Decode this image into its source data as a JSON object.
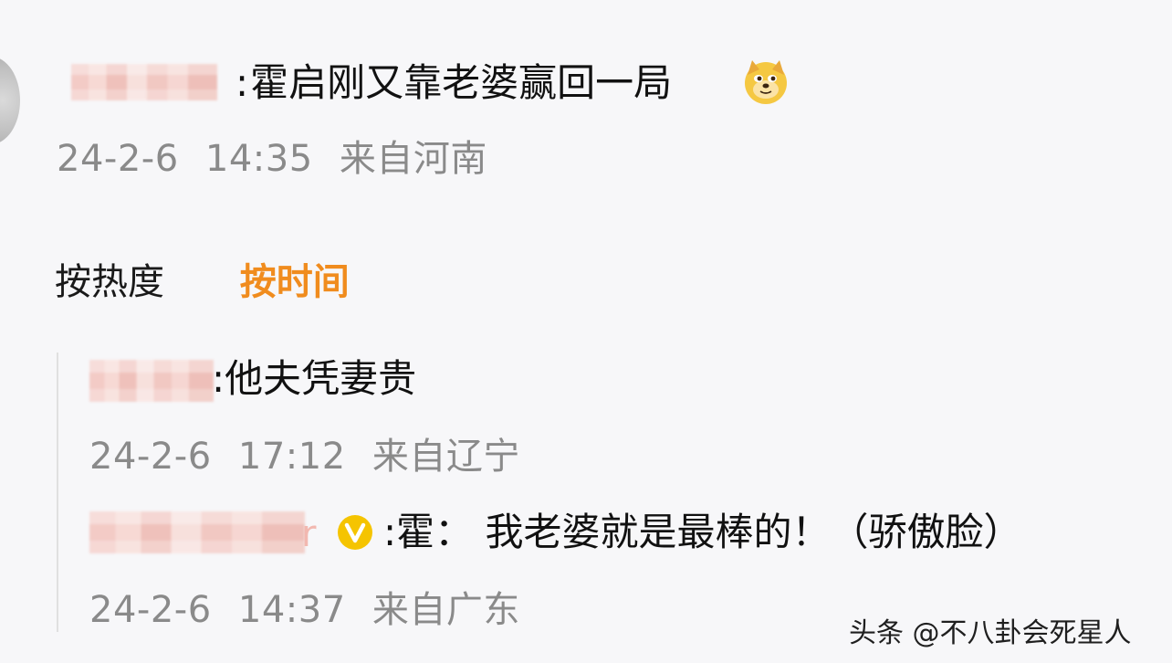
{
  "post": {
    "author_tail": "ı",
    "colon": ":",
    "text": "霍启刚又靠老婆赢回一局",
    "emoji": "doge-emoji",
    "date": "24-2-6",
    "time": "14:35",
    "location": "来自河南"
  },
  "sort": {
    "by_hot": "按热度",
    "by_time": "按时间",
    "active": "by_time",
    "active_color": "#f08c1e"
  },
  "replies": [
    {
      "colon": ":",
      "text": "他夫凭妻贵",
      "date": "24-2-6",
      "time": "17:12",
      "location": "来自辽宁"
    },
    {
      "name_tail": "r",
      "verified": true,
      "verified_color": "#f5c400",
      "colon": ":",
      "text": "霍：  我老婆就是最棒的！（骄傲脸）",
      "date": "24-2-6",
      "time": "14:37",
      "location": "来自广东"
    }
  ],
  "watermark": "头条 @不八卦会死星人",
  "colors": {
    "meta_gray": "#8a8a8a",
    "background": "#f7f7f9"
  }
}
